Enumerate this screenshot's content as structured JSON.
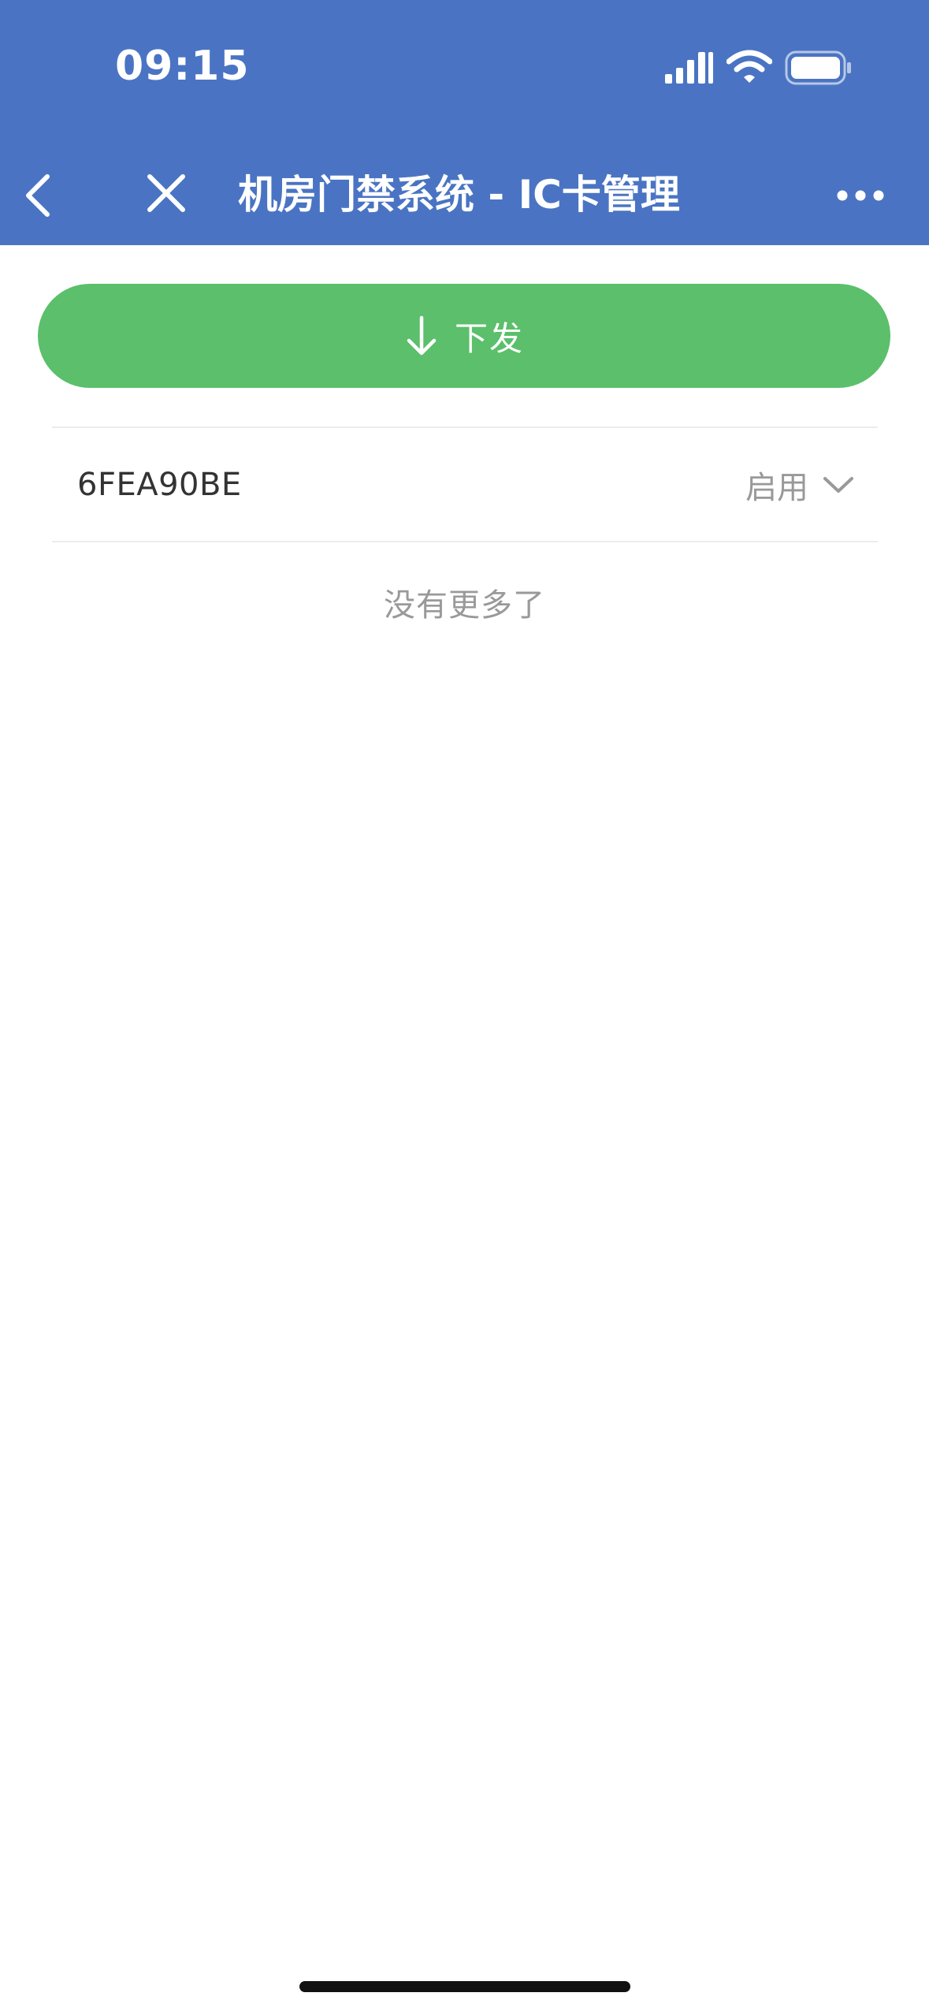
{
  "status_bar": {
    "time": "09:15"
  },
  "nav": {
    "title": "机房门禁系统 - IC卡管理",
    "icons": {
      "back": "chevron-left-icon",
      "close": "close-icon",
      "more": "more-dots-icon"
    }
  },
  "actions": {
    "issue_label": "下发",
    "issue_icon": "arrow-down-icon"
  },
  "cards": [
    {
      "id": "6FEA90BE",
      "status": "启用"
    }
  ],
  "list_end_text": "没有更多了",
  "colors": {
    "header": "#4a74c3",
    "primary_button": "#5bbf6b",
    "text_primary": "#333333",
    "text_secondary": "#999999"
  }
}
